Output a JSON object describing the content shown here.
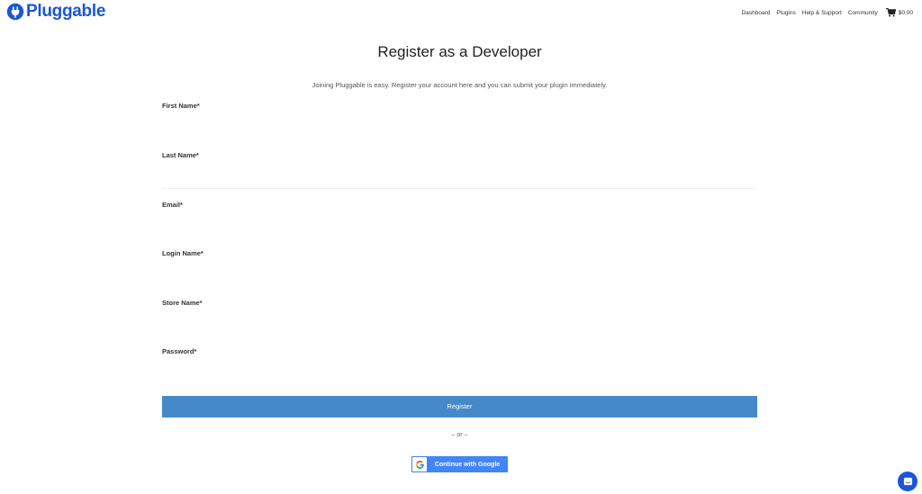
{
  "header": {
    "logo_text": "Pluggable",
    "nav": [
      {
        "label": "Dashboard"
      },
      {
        "label": "Plugins"
      },
      {
        "label": "Help & Support"
      },
      {
        "label": "Community"
      }
    ],
    "cart_amount": "$0.00"
  },
  "main": {
    "title": "Register as a Developer",
    "intro": "Joining Pluggable is easy. Register your account here and you can submit your plugin immediately.",
    "fields": [
      {
        "label": "First Name*",
        "value": ""
      },
      {
        "label": "Last Name*",
        "value": ""
      },
      {
        "label": "Email*",
        "value": ""
      },
      {
        "label": "Login Name*",
        "value": ""
      },
      {
        "label": "Store Name*",
        "value": ""
      },
      {
        "label": "Password*",
        "value": ""
      }
    ],
    "register_label": "Register",
    "or_label": "– or –",
    "google_label": "Continue with Google"
  },
  "colors": {
    "brand": "#1a56db",
    "register_button": "#4589c9",
    "google_button": "#4285f4"
  },
  "icons": [
    "plug-logo-icon",
    "cart-icon",
    "google-logo-icon",
    "chat-icon"
  ]
}
